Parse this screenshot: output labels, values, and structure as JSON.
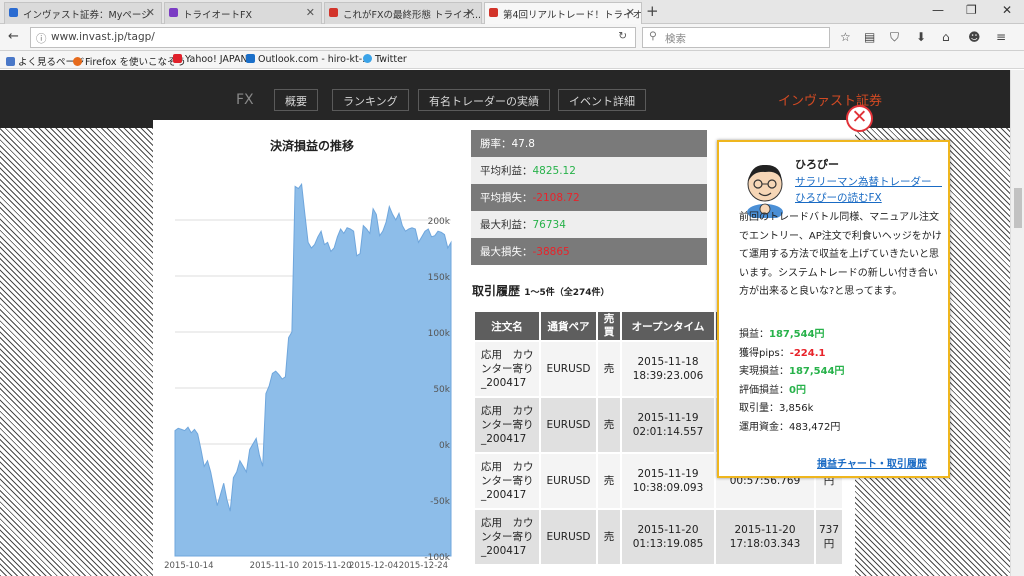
{
  "browser": {
    "tabs": [
      {
        "title": "インヴァスト証券：Myページ",
        "color": "#2a6bd1"
      },
      {
        "title": "トライオートFX",
        "color": "#7b3cc4"
      },
      {
        "title": "これがFXの最終形態 トライオ...",
        "color": "#d2342a"
      },
      {
        "title": "第4回リアルトレード！トライオートF...",
        "color": "#d2342a"
      }
    ],
    "url": "www.invast.jp/tagp/",
    "search_placeholder": "検索",
    "bookmarks": [
      {
        "label": "よく見るページ",
        "color": "#4a78c8"
      },
      {
        "label": "Firefox を使いこなそう",
        "color": "#e66a1c"
      },
      {
        "label": "Yahoo! JAPAN",
        "color": "#e0202a"
      },
      {
        "label": "Outlook.com - hiro-kt-...",
        "color": "#1a6fc9"
      },
      {
        "label": "Twitter",
        "color": "#3aa3e8"
      }
    ]
  },
  "site": {
    "active_tab": "統計情報",
    "logo_suffix": "FX",
    "nav": [
      "概要",
      "ランキング",
      "有名トレーダーの実績",
      "イベント詳細"
    ],
    "brand": "インヴァスト証券"
  },
  "chart_data": {
    "type": "area",
    "title": "決済損益の推移",
    "ylim": [
      -100000,
      250000
    ],
    "y_ticks": [
      "200k",
      "150k",
      "100k",
      "50k",
      "0k",
      "-50k",
      "-100k"
    ],
    "y_tick_values": [
      200000,
      150000,
      100000,
      50000,
      0,
      -50000,
      -100000
    ],
    "x_ticks": [
      "2015-10-14",
      "2015-11-10",
      "2015-11-20",
      "2015-12-04",
      "2015-12-24"
    ],
    "x_tick_positions": [
      0.05,
      0.36,
      0.55,
      0.72,
      0.9
    ],
    "grid": true,
    "color": "#8dbde9",
    "values": [
      12000,
      14000,
      13000,
      12000,
      15000,
      10000,
      13000,
      9000,
      -5000,
      -20000,
      -15000,
      -25000,
      -40000,
      -55000,
      -45000,
      -35000,
      -50000,
      -60000,
      -30000,
      -25000,
      -15000,
      -20000,
      -25000,
      -5000,
      0,
      5000,
      -10000,
      -20000,
      45000,
      52000,
      63000,
      65000,
      62000,
      58000,
      60000,
      95000,
      100000,
      230000,
      228000,
      232000,
      205000,
      180000,
      175000,
      178000,
      185000,
      190000,
      178000,
      180000,
      172000,
      175000,
      185000,
      192000,
      188000,
      193000,
      192000,
      190000,
      168000,
      170000,
      195000,
      192000,
      188000,
      210000,
      205000,
      186000,
      190000,
      198000,
      212000,
      205000,
      200000,
      206000,
      195000,
      190000,
      192000,
      193000,
      192000,
      180000,
      185000,
      190000,
      192000,
      185000,
      186000,
      190000,
      189000,
      187000,
      175000,
      180000
    ]
  },
  "stats": [
    {
      "label": "勝率：",
      "value": "47.8",
      "value_class": ""
    },
    {
      "label": "平均利益：",
      "value": "4825.12",
      "value_class": "green"
    },
    {
      "label": "平均損失：",
      "value": "-2108.72",
      "value_class": "red"
    },
    {
      "label": "最大利益：",
      "value": "76734",
      "value_class": "green"
    },
    {
      "label": "最大損失：",
      "value": "-38865",
      "value_class": "red"
    }
  ],
  "history": {
    "title": "取引履歴",
    "count": "1～5件（全274件）",
    "headers": [
      "注文名",
      "通貨ペア",
      "売買",
      "オープンタイム",
      "",
      ""
    ],
    "rows": [
      {
        "name": "応用　カウンター寄り_200417",
        "pair": "EURUSD",
        "side": "売",
        "open": "2015-11-18 18:39:23.006",
        "close": "",
        "pl": ""
      },
      {
        "name": "応用　カウンター寄り_200417",
        "pair": "EURUSD",
        "side": "売",
        "open": "2015-11-19 02:01:14.557",
        "close": "",
        "pl": ""
      },
      {
        "name": "応用　カウンター寄り_200417",
        "pair": "EURUSD",
        "side": "売",
        "open": "2015-11-19 10:38:09.093",
        "close": "00:57:56.769",
        "pl": "円"
      },
      {
        "name": "応用　カウンター寄り_200417",
        "pair": "EURUSD",
        "side": "売",
        "open": "2015-11-20 01:13:19.085",
        "close": "2015-11-20 17:18:03.343",
        "pl": "737円"
      }
    ]
  },
  "trader": {
    "name": "ひろぴー",
    "link": "サラリーマン為替トレーダー　ひろぴーの読むFX",
    "desc": "前回のトレードバトル同様、マニュアル注文でエントリー、AP注文で利食いヘッジをかけて運用する方法で収益を上げていきたいと思います。システムトレードの新しい付き合い方が出来ると良いな?と思ってます。",
    "stats": [
      {
        "label": "損益：",
        "value": "187,544円",
        "cls": "green"
      },
      {
        "label": "獲得pips：",
        "value": "-224.1",
        "cls": "red"
      },
      {
        "label": "実現損益：",
        "value": "187,544円",
        "cls": "green"
      },
      {
        "label": "評価損益：",
        "value": "0円",
        "cls": "green"
      },
      {
        "label": "取引量：",
        "value": "3,856k",
        "cls": ""
      },
      {
        "label": "運用資金：",
        "value": "483,472円",
        "cls": ""
      }
    ],
    "footer_link": "損益チャート・取引履歴"
  }
}
